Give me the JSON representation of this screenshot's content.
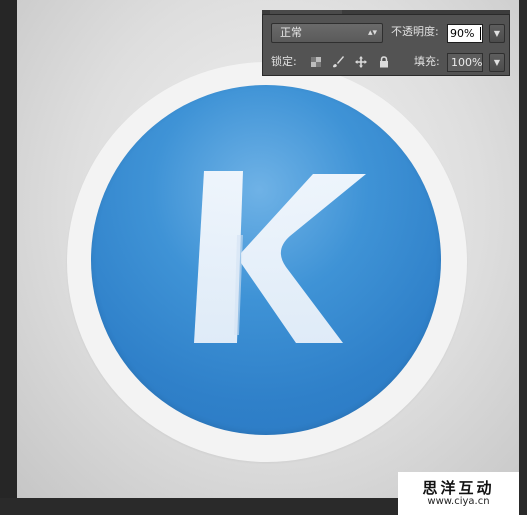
{
  "layers_panel": {
    "blend_mode": "正常",
    "opacity_label": "不透明度:",
    "opacity_value": "90%",
    "lock_label": "锁定:",
    "fill_label": "填充:",
    "fill_value": "100%",
    "lock_icons": [
      "lock-transparent-pixels-icon",
      "lock-image-pixels-icon",
      "lock-position-icon",
      "lock-all-icon"
    ]
  },
  "artwork": {
    "logo_letter": "K",
    "disc_color": "#2f80c9",
    "ring_color": "#f3f3f3",
    "letter_color": "#eef4fb"
  },
  "watermark": {
    "name": "思洋互动",
    "url": "www.ciya.cn"
  }
}
